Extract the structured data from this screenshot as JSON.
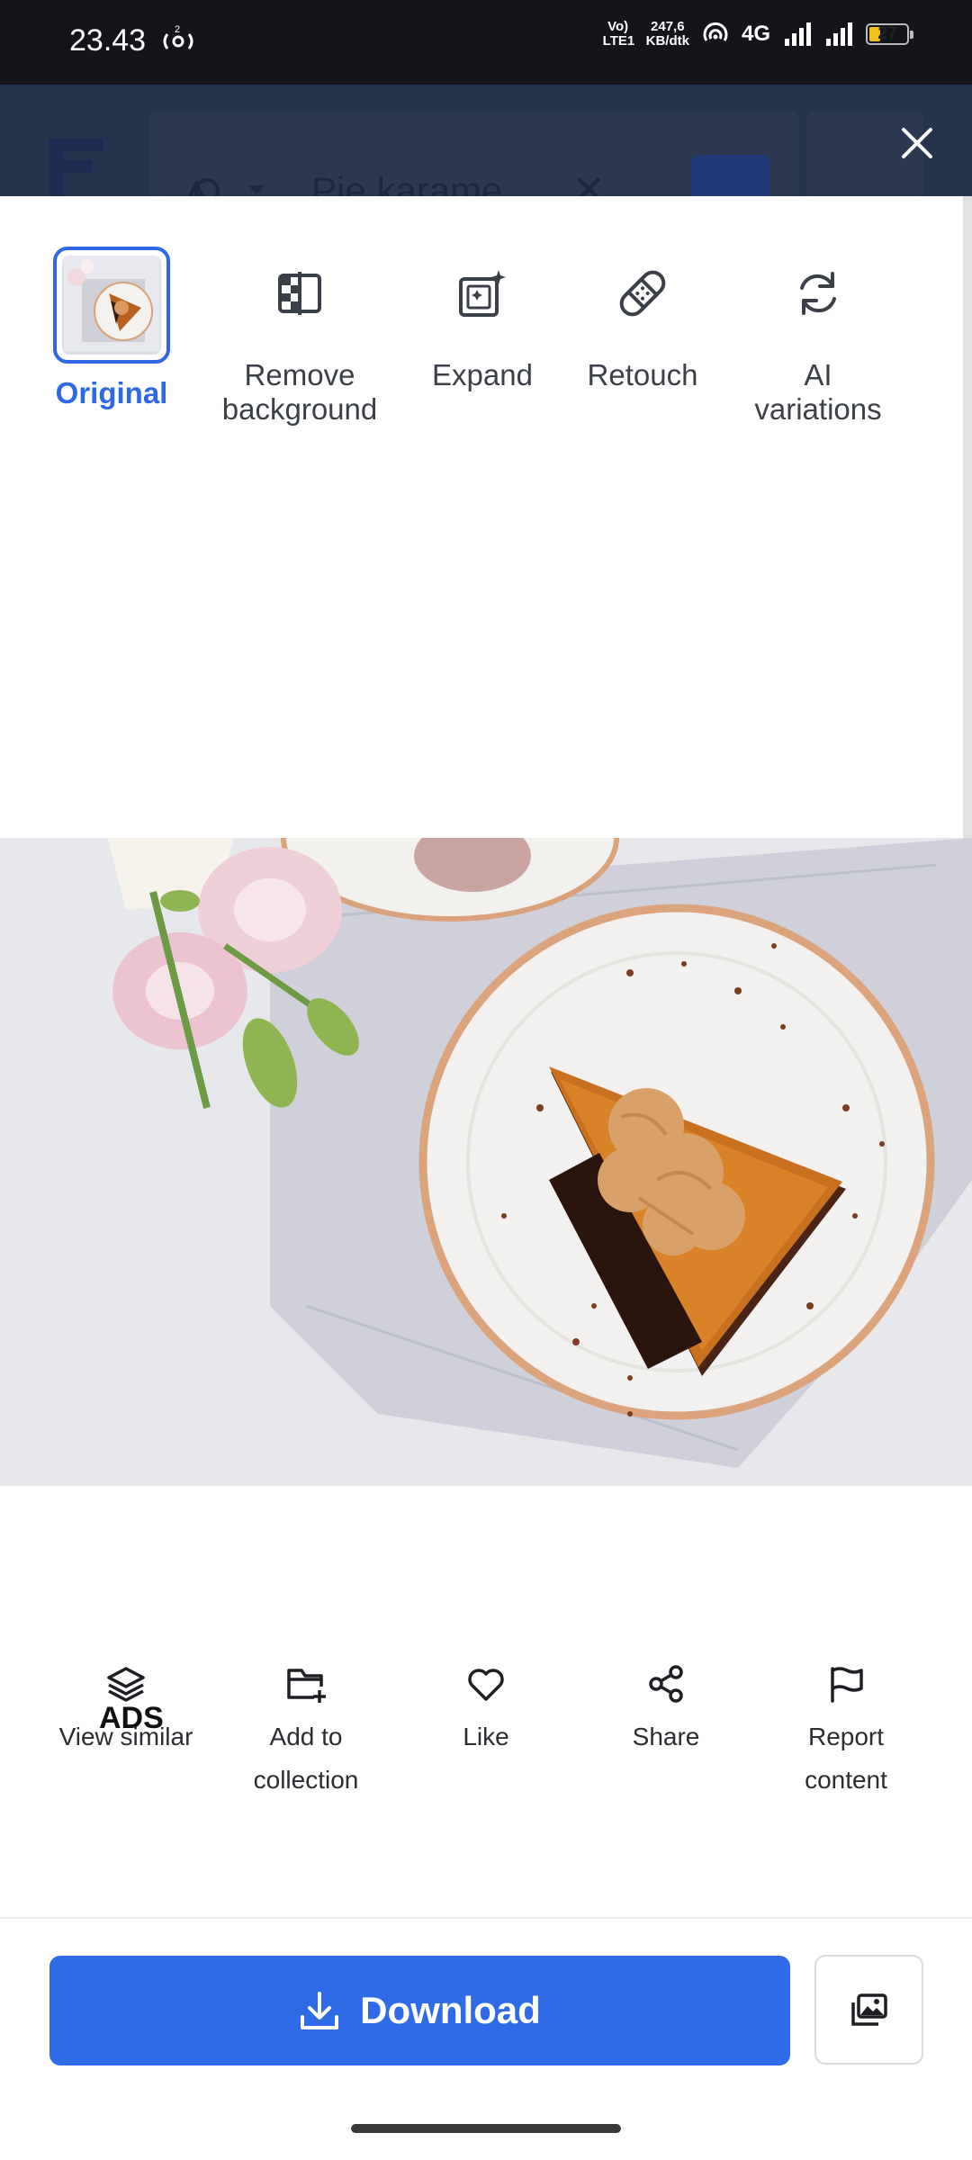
{
  "status_bar": {
    "time": "23.43",
    "hotspot_count": "2",
    "network_small": "Vo) LTE1",
    "speed": "247,6",
    "speed_unit": "KB/dtk",
    "network_type": "4G",
    "battery": "27"
  },
  "app_header": {
    "search_query": "Pie karame"
  },
  "tools": [
    {
      "label": "Original",
      "icon": "image-thumbnail"
    },
    {
      "label": "Remove\nbackground",
      "icon": "remove-background-icon"
    },
    {
      "label": "Expand",
      "icon": "expand-icon"
    },
    {
      "label": "Retouch",
      "icon": "bandage-icon"
    },
    {
      "label": "AI\nvariations",
      "icon": "refresh-icon"
    }
  ],
  "photo": {
    "subject": "caramel-cake-slice"
  },
  "actions": [
    {
      "label": "View similar",
      "icon": "layers-icon"
    },
    {
      "label": "Add to\ncollection",
      "icon": "folder-plus-icon"
    },
    {
      "label": "Like",
      "icon": "heart-icon"
    },
    {
      "label": "Share",
      "icon": "share-icon"
    },
    {
      "label": "Report\ncontent",
      "icon": "flag-icon"
    }
  ],
  "ads_label": "ADS",
  "download": {
    "label": "Download",
    "icon": "download-icon"
  },
  "colors": {
    "accent": "#2f6be6",
    "status_bar": "#13151a",
    "app_header_dimmed": "#26334d"
  }
}
